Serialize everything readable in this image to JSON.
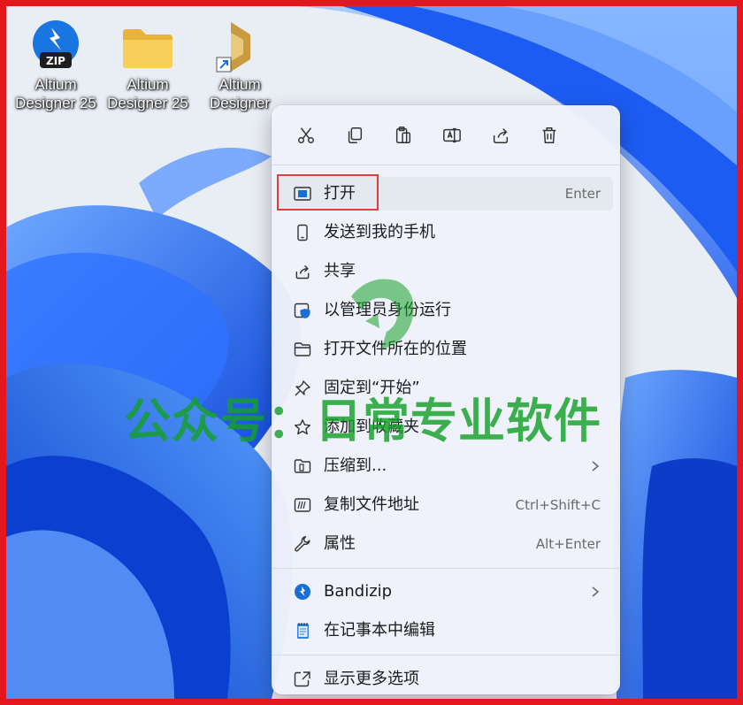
{
  "desktop": {
    "icons": [
      {
        "line1": "Altium",
        "line2": "Designer 25",
        "icon": "zip-archive-icon"
      },
      {
        "line1": "Altium",
        "line2": "Designer 25",
        "icon": "folder-icon"
      },
      {
        "line1": "Altium",
        "line2": "Designer",
        "icon": "altium-logo-icon"
      }
    ]
  },
  "toolbar": {
    "actions": [
      "cut-icon",
      "copy-icon",
      "paste-icon",
      "rename-icon",
      "share-icon",
      "delete-icon"
    ]
  },
  "menu": {
    "items": [
      {
        "label": "打开",
        "shortcut": "Enter",
        "icon": "open-window-icon"
      },
      {
        "label": "发送到我的手机",
        "icon": "phone-icon"
      },
      {
        "label": "共享",
        "icon": "share-icon"
      },
      {
        "label": "以管理员身份运行",
        "icon": "admin-shield-icon"
      },
      {
        "label": "打开文件所在的位置",
        "icon": "folder-outline-icon"
      },
      {
        "label": "固定到“开始”",
        "icon": "pin-icon"
      },
      {
        "label": "添加到收藏夹",
        "icon": "star-icon"
      },
      {
        "label": "压缩到...",
        "icon": "zip-folder-icon",
        "submenu": true
      },
      {
        "label": "复制文件地址",
        "shortcut": "Ctrl+Shift+C",
        "icon": "copy-path-icon"
      },
      {
        "label": "属性",
        "shortcut": "Alt+Enter",
        "icon": "wrench-icon"
      },
      {
        "label": "Bandizip",
        "icon": "bandizip-icon",
        "submenu": true
      },
      {
        "label": "在记事本中编辑",
        "icon": "notepad-icon"
      },
      {
        "label": "显示更多选项",
        "icon": "more-options-icon"
      }
    ]
  },
  "watermark": {
    "text": "公众号：日常专业软件"
  },
  "colors": {
    "frame": "#e4181c",
    "highlight": "#e43a3a",
    "watermark": "#14a028",
    "accent": "#0a5fc8"
  }
}
